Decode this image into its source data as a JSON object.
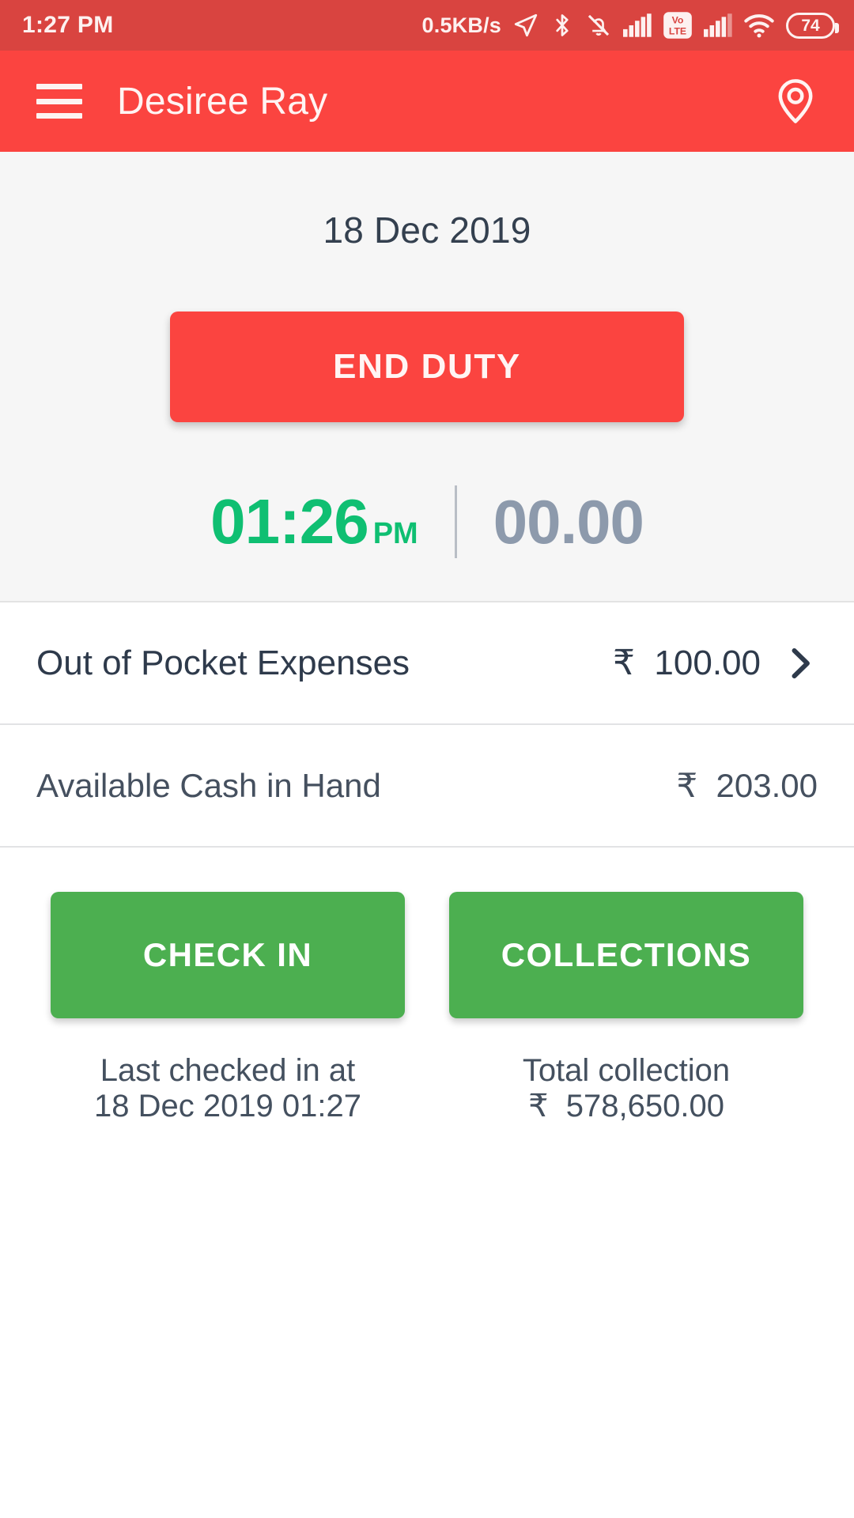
{
  "status_bar": {
    "time": "1:27 PM",
    "network_speed": "0.5KB/s",
    "battery_level": "74",
    "icons": [
      "location-arrow-icon",
      "bluetooth-icon",
      "mute-bell-icon",
      "signal-bars-icon",
      "volte-icon",
      "signal-bars-2-icon",
      "wifi-icon",
      "battery-icon"
    ],
    "volte_top": "Vo",
    "volte_bottom": "LTE"
  },
  "app_bar": {
    "title": "Desiree Ray",
    "menu_icon": "hamburger-menu-icon",
    "location_icon": "map-pin-icon"
  },
  "duty": {
    "date": "18 Dec 2019",
    "end_duty_label": "END DUTY",
    "clock_time": "01:26",
    "clock_ampm": "PM",
    "odometer": "00.00"
  },
  "rows": [
    {
      "label": "Out of Pocket Expenses",
      "value": "₹  100.00",
      "has_chevron": true
    },
    {
      "label": "Available Cash in Hand",
      "value": "₹  203.00",
      "has_chevron": false
    }
  ],
  "actions": [
    {
      "label": "CHECK IN",
      "caption_line1": "Last checked in at",
      "caption_line2": "18 Dec 2019 01:27"
    },
    {
      "label": "COLLECTIONS",
      "caption_line1": "Total collection",
      "caption_line2": "₹  578,650.00"
    }
  ],
  "colors": {
    "status_bar": "#D94440",
    "app_bar": "#FB4440",
    "primary_red": "#FB4440",
    "green_accent": "#0FBF72",
    "green_button": "#4CAF50",
    "odometer_gray": "#8D9AAC",
    "panel_bg": "#F6F6F6",
    "text_dark": "#2E3A4B"
  }
}
